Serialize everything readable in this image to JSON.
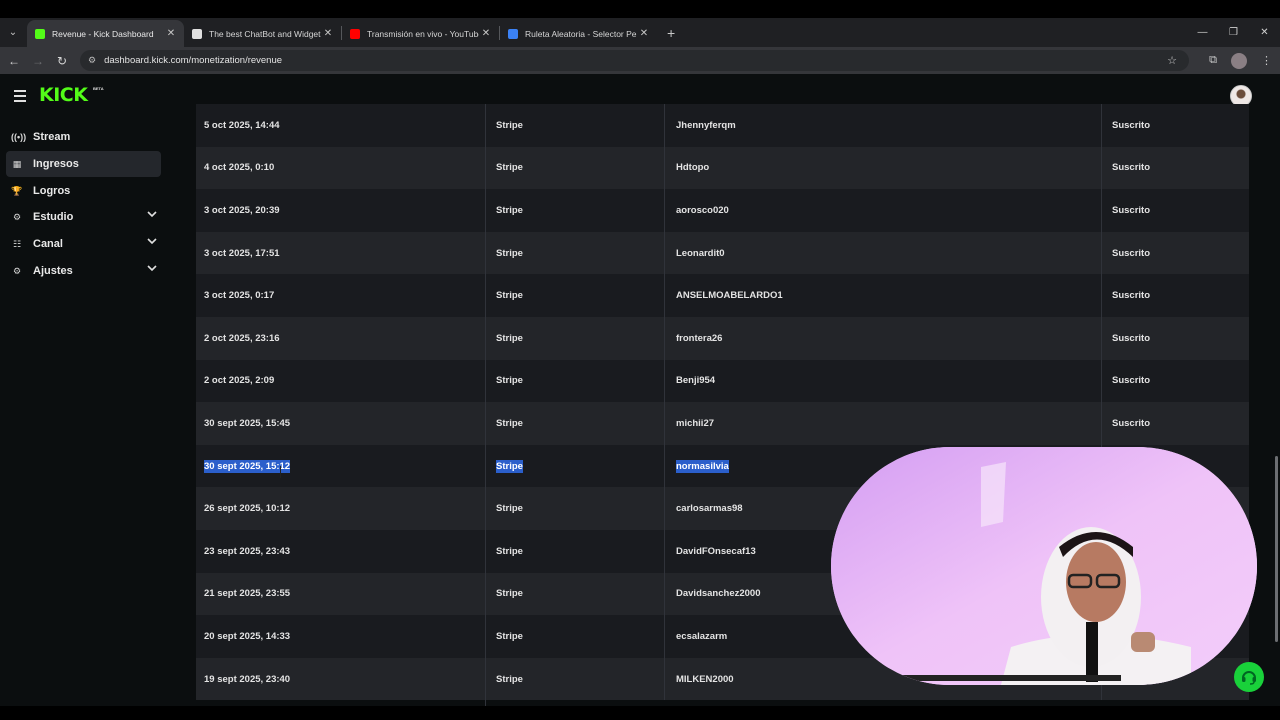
{
  "browser": {
    "tabs": [
      {
        "title": "Revenue - Kick Dashboard",
        "favicon_color": "#53fc18",
        "active": true
      },
      {
        "title": "The best ChatBot and Widgets",
        "favicon_color": "#e0e0e0",
        "active": false
      },
      {
        "title": "Transmisión en vivo - YouTube",
        "favicon_color": "#ff0000",
        "active": false
      },
      {
        "title": "Ruleta Aleatoria - Selector Pers",
        "favicon_color": "#3b82f6",
        "active": false
      }
    ],
    "tab_close": "✕",
    "new_tab": "+",
    "url": "dashboard.kick.com/monetization/revenue"
  },
  "header": {
    "logo": "KICK",
    "logo_badge": "BETA"
  },
  "sidebar": {
    "items": [
      {
        "label": "Stream",
        "icon": "broadcast-icon",
        "glyph": "((•))",
        "active": false,
        "expandable": false
      },
      {
        "label": "Ingresos",
        "icon": "revenue-icon",
        "glyph": "▦",
        "active": true,
        "expandable": false
      },
      {
        "label": "Logros",
        "icon": "trophy-icon",
        "glyph": "🏆",
        "active": false,
        "expandable": false
      },
      {
        "label": "Estudio",
        "icon": "studio-icon",
        "glyph": "⚙",
        "active": false,
        "expandable": true
      },
      {
        "label": "Canal",
        "icon": "channel-icon",
        "glyph": "☷",
        "active": false,
        "expandable": true
      },
      {
        "label": "Ajustes",
        "icon": "settings-icon",
        "glyph": "⚙",
        "active": false,
        "expandable": true
      }
    ]
  },
  "table": {
    "rows": [
      {
        "date": "5 oct 2025, 14:44",
        "method": "Stripe",
        "user": "Jhennyferqm",
        "type": "Suscrito"
      },
      {
        "date": "4 oct 2025, 0:10",
        "method": "Stripe",
        "user": "Hdtopo",
        "type": "Suscrito"
      },
      {
        "date": "3 oct 2025, 20:39",
        "method": "Stripe",
        "user": "aorosco020",
        "type": "Suscrito"
      },
      {
        "date": "3 oct 2025, 17:51",
        "method": "Stripe",
        "user": "Leonardit0",
        "type": "Suscrito"
      },
      {
        "date": "3 oct 2025, 0:17",
        "method": "Stripe",
        "user": "ANSELMOABELARDO1",
        "type": "Suscrito"
      },
      {
        "date": "2 oct 2025, 23:16",
        "method": "Stripe",
        "user": "frontera26",
        "type": "Suscrito"
      },
      {
        "date": "2 oct 2025, 2:09",
        "method": "Stripe",
        "user": "Benji954",
        "type": "Suscrito"
      },
      {
        "date": "30 sept 2025, 15:45",
        "method": "Stripe",
        "user": "michii27",
        "type": "Suscrito"
      },
      {
        "date": "30 sept 2025, 15:12",
        "method": "Stripe",
        "user": "normasilvia",
        "type": "",
        "selected": true
      },
      {
        "date": "26 sept 2025, 10:12",
        "method": "Stripe",
        "user": "carlosarmas98",
        "type": ""
      },
      {
        "date": "23 sept 2025, 23:43",
        "method": "Stripe",
        "user": "DavidFOnsecaf13",
        "type": ""
      },
      {
        "date": "21 sept 2025, 23:55",
        "method": "Stripe",
        "user": "Davidsanchez2000",
        "type": ""
      },
      {
        "date": "20 sept 2025, 14:33",
        "method": "Stripe",
        "user": "ecsalazarm",
        "type": ""
      },
      {
        "date": "19 sept 2025, 23:40",
        "method": "Stripe",
        "user": "MILKEN2000",
        "type": ""
      }
    ]
  },
  "colors": {
    "brand": "#53fc18",
    "selection": "#2b5fcb",
    "chat_button": "#19d13a"
  }
}
